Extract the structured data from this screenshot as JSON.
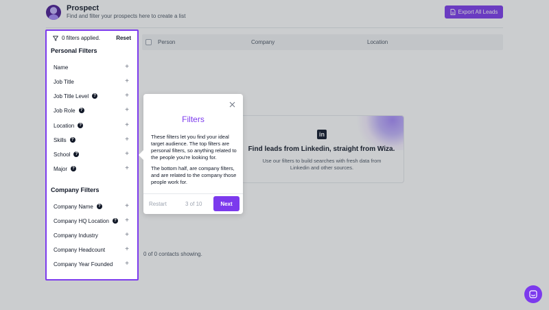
{
  "header": {
    "title": "Prospect",
    "subtitle": "Find and filter your prospects here to create a list",
    "export_label": "Export All Leads"
  },
  "table": {
    "columns": [
      "Person",
      "Company",
      "Location"
    ]
  },
  "empty_state": {
    "logo_text": "in",
    "title": "Find leads from Linkedin, straight from Wiza.",
    "description": "Use our filters to build searches with fresh data from Linkedin and other sources."
  },
  "contacts_count": "0 of 0 contacts showing.",
  "sidebar": {
    "filters_applied": "0 filters applied.",
    "reset_label": "Reset",
    "personal_title": "Personal Filters",
    "personal_filters": [
      {
        "label": "Name",
        "help": false
      },
      {
        "label": "Job Title",
        "help": false
      },
      {
        "label": "Job Title Level",
        "help": true
      },
      {
        "label": "Job Role",
        "help": true
      },
      {
        "label": "Location",
        "help": true
      },
      {
        "label": "Skills",
        "help": true
      },
      {
        "label": "School",
        "help": true
      },
      {
        "label": "Major",
        "help": true
      }
    ],
    "company_title": "Company Filters",
    "company_filters": [
      {
        "label": "Company Name",
        "help": true
      },
      {
        "label": "Company HQ Location",
        "help": true
      },
      {
        "label": "Company Industry",
        "help": false
      },
      {
        "label": "Company Headcount",
        "help": false
      },
      {
        "label": "Company Year Founded",
        "help": false
      }
    ],
    "help_glyph": "?",
    "plus_glyph": "+"
  },
  "tour": {
    "title": "Filters",
    "paragraph_1": "These filters let you find your ideal target audience. The top filters are personal filters, so anything related to the people you're looking for.",
    "paragraph_2": "The bottom half, are company filters, and are related to the company those people work for.",
    "restart_label": "Restart",
    "step_label": "3 of 10",
    "next_label": "Next"
  },
  "colors": {
    "accent": "#7c3aed",
    "overlay": "#373c46"
  },
  "icons": {
    "filter": "filter-icon",
    "export": "document-icon",
    "close": "close-icon",
    "chat": "chat-icon"
  }
}
